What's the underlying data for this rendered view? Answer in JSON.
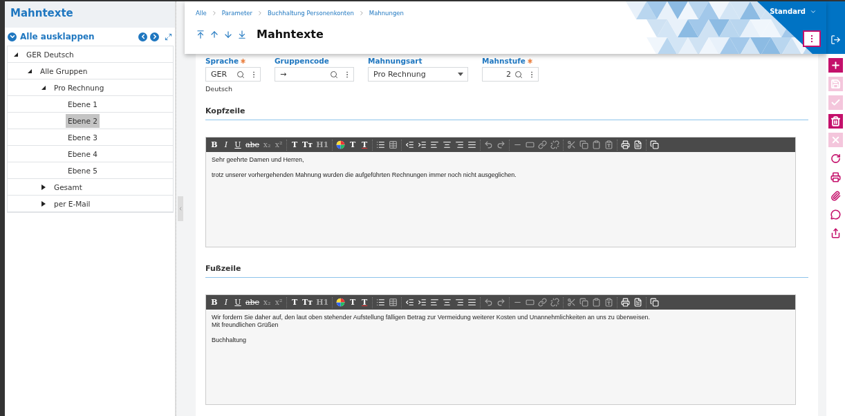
{
  "sidebar": {
    "title": "Mahntexte",
    "expand_all": "Alle ausklappen",
    "tree": [
      {
        "label": "GER Deutsch",
        "expanded": true,
        "selected": false,
        "children": [
          {
            "label": "Alle Gruppen",
            "expanded": true,
            "selected": false,
            "children": [
              {
                "label": "Pro Rechnung",
                "expanded": true,
                "selected": false,
                "children": [
                  {
                    "label": "Ebene 1",
                    "selected": false
                  },
                  {
                    "label": "Ebene 2",
                    "selected": true
                  },
                  {
                    "label": "Ebene 3",
                    "selected": false
                  },
                  {
                    "label": "Ebene 4",
                    "selected": false
                  },
                  {
                    "label": "Ebene 5",
                    "selected": false
                  }
                ]
              },
              {
                "label": "Gesamt",
                "expanded": false,
                "selected": false
              },
              {
                "label": "per E-Mail",
                "expanded": false,
                "selected": false
              }
            ]
          }
        ]
      }
    ]
  },
  "breadcrumb": [
    "Alle",
    "Parameter",
    "Buchhaltung Personenkonten",
    "Mahnungen"
  ],
  "page_title": "Mahntexte",
  "profile": "Standard",
  "fields": [
    {
      "kind": "lookup",
      "label": "Sprache",
      "required": true,
      "value": "GER",
      "note": "Deutsch"
    },
    {
      "kind": "lookup",
      "label": "Gruppencode",
      "required": false,
      "value": "→"
    },
    {
      "kind": "select",
      "label": "Mahnungsart",
      "required": false,
      "value": "Pro Rechnung"
    },
    {
      "kind": "number",
      "label": "Mahnstufe",
      "required": true,
      "value": "2"
    }
  ],
  "sections": [
    {
      "title": "Kopfzeile",
      "paragraphs": [
        [
          "Sehr geehrte Damen und Herren,"
        ],
        [
          "trotz unserer vorhergehenden Mahnung wurden die aufgeführten Rechnungen immer noch nicht ausgeglichen."
        ]
      ],
      "toolbar": [
        {
          "kind": "bold",
          "label": "B",
          "disabled": false
        },
        {
          "kind": "italic",
          "label": "I",
          "disabled": false
        },
        {
          "kind": "underline",
          "label": "U",
          "disabled": false
        },
        {
          "kind": "strike",
          "label": "abe",
          "disabled": false
        },
        {
          "kind": "sub",
          "label": "x₂",
          "disabled": true
        },
        {
          "kind": "sup",
          "label": "x²",
          "disabled": true
        },
        {
          "kind": "sep"
        },
        {
          "kind": "text",
          "label": "T",
          "disabled": false
        },
        {
          "kind": "text",
          "label": "Tт",
          "disabled": false
        },
        {
          "kind": "text",
          "label": "H1",
          "disabled": true
        },
        {
          "kind": "sep"
        },
        {
          "kind": "color",
          "disabled": false
        },
        {
          "kind": "text",
          "label": "T",
          "disabled": false
        },
        {
          "kind": "clear",
          "label": "T",
          "disabled": false
        },
        {
          "kind": "sep"
        },
        {
          "kind": "list",
          "disabled": false
        },
        {
          "kind": "table",
          "disabled": true
        },
        {
          "kind": "sep"
        },
        {
          "kind": "outdent",
          "disabled": false
        },
        {
          "kind": "indent",
          "disabled": false
        },
        {
          "kind": "left",
          "disabled": false
        },
        {
          "kind": "center",
          "disabled": false
        },
        {
          "kind": "right",
          "disabled": false
        },
        {
          "kind": "justify",
          "disabled": false
        },
        {
          "kind": "sep"
        },
        {
          "kind": "undo",
          "disabled": true
        },
        {
          "kind": "redo",
          "disabled": true
        },
        {
          "kind": "sep"
        },
        {
          "kind": "rule",
          "disabled": true
        },
        {
          "kind": "field",
          "disabled": true
        },
        {
          "kind": "link",
          "disabled": true
        },
        {
          "kind": "unlink",
          "disabled": true
        },
        {
          "kind": "sep"
        },
        {
          "kind": "cut",
          "disabled": true
        },
        {
          "kind": "copy",
          "disabled": true
        },
        {
          "kind": "paste",
          "disabled": true
        },
        {
          "kind": "pastetext",
          "disabled": true
        },
        {
          "kind": "sep"
        },
        {
          "kind": "print",
          "disabled": false
        },
        {
          "kind": "template",
          "disabled": false
        },
        {
          "kind": "sep"
        },
        {
          "kind": "maximize",
          "disabled": false
        }
      ]
    },
    {
      "title": "Fußzeile",
      "paragraphs": [
        [
          "Wir fordern Sie daher auf, den laut oben stehender Aufstellung fälligen Betrag zur Vermeidung weiterer Kosten und Unannehmlichkeiten an uns zu überweisen.",
          "Mit freundlichen Grüßen"
        ],
        [
          "Buchhaltung"
        ]
      ],
      "toolbar": [
        {
          "kind": "bold",
          "label": "B",
          "disabled": false
        },
        {
          "kind": "italic",
          "label": "I",
          "disabled": false
        },
        {
          "kind": "underline",
          "label": "U",
          "disabled": false
        },
        {
          "kind": "strike",
          "label": "abe",
          "disabled": false
        },
        {
          "kind": "sub",
          "label": "x₂",
          "disabled": true
        },
        {
          "kind": "sup",
          "label": "x²",
          "disabled": true
        },
        {
          "kind": "sep"
        },
        {
          "kind": "text",
          "label": "T",
          "disabled": false
        },
        {
          "kind": "text",
          "label": "Tт",
          "disabled": false
        },
        {
          "kind": "text",
          "label": "H1",
          "disabled": true
        },
        {
          "kind": "sep"
        },
        {
          "kind": "color",
          "disabled": false
        },
        {
          "kind": "text",
          "label": "T",
          "disabled": false
        },
        {
          "kind": "clear",
          "label": "T",
          "disabled": false
        },
        {
          "kind": "sep"
        },
        {
          "kind": "list",
          "disabled": false
        },
        {
          "kind": "table",
          "disabled": true
        },
        {
          "kind": "sep"
        },
        {
          "kind": "outdent",
          "disabled": false
        },
        {
          "kind": "indent",
          "disabled": false
        },
        {
          "kind": "left",
          "disabled": false
        },
        {
          "kind": "center",
          "disabled": false
        },
        {
          "kind": "right",
          "disabled": false
        },
        {
          "kind": "justify",
          "disabled": false
        },
        {
          "kind": "sep"
        },
        {
          "kind": "undo",
          "disabled": true
        },
        {
          "kind": "redo",
          "disabled": true
        },
        {
          "kind": "sep"
        },
        {
          "kind": "rule",
          "disabled": true
        },
        {
          "kind": "field",
          "disabled": true
        },
        {
          "kind": "link",
          "disabled": true
        },
        {
          "kind": "unlink",
          "disabled": true
        },
        {
          "kind": "sep"
        },
        {
          "kind": "cut",
          "disabled": true
        },
        {
          "kind": "copy",
          "disabled": true
        },
        {
          "kind": "paste",
          "disabled": true
        },
        {
          "kind": "pastetext",
          "disabled": true
        },
        {
          "kind": "sep"
        },
        {
          "kind": "print",
          "disabled": false
        },
        {
          "kind": "template",
          "disabled": false
        },
        {
          "kind": "sep"
        },
        {
          "kind": "maximize",
          "disabled": false
        }
      ]
    }
  ],
  "actions": [
    {
      "kind": "add",
      "disabled": false
    },
    {
      "kind": "save",
      "disabled": true
    },
    {
      "kind": "confirm",
      "disabled": true
    },
    {
      "kind": "delete",
      "disabled": false
    },
    {
      "kind": "cancel",
      "disabled": true
    },
    {
      "kind": "refresh",
      "disabled": false
    },
    {
      "kind": "print",
      "disabled": false
    },
    {
      "kind": "attach",
      "disabled": false
    },
    {
      "kind": "comment",
      "disabled": false
    },
    {
      "kind": "export",
      "disabled": false
    }
  ]
}
